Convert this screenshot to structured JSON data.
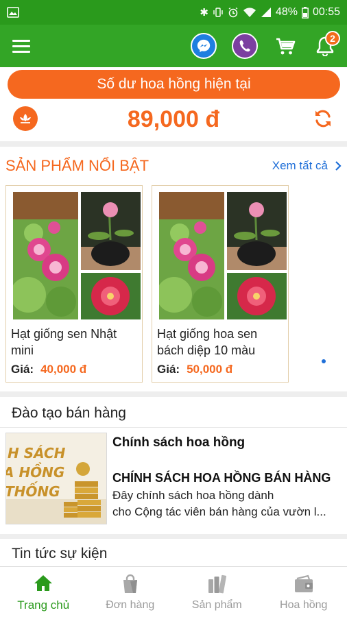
{
  "status_bar": {
    "battery": "48%",
    "time": "00:55",
    "icons": [
      "image-icon",
      "bluetooth-icon",
      "vibrate-icon",
      "alarm-icon",
      "wifi-icon",
      "signal-icon",
      "battery-icon"
    ]
  },
  "app_bar": {
    "icons": [
      "menu-icon",
      "messenger-icon",
      "viber-icon",
      "cart-icon",
      "bell-icon"
    ],
    "notification_count": "2"
  },
  "balance": {
    "label": "Số dư hoa hồng hiện tại",
    "amount": "89,000 đ"
  },
  "featured": {
    "title": "SẢN PHẨM NỔI BẬT",
    "see_all": "Xem tất cả",
    "products": [
      {
        "name_line1": "Hạt giống sen Nhật",
        "name_line2": "mini",
        "price_label": "Giá:",
        "price": "40,000 đ"
      },
      {
        "name_line1": "Hạt giống hoa sen",
        "name_line2": "bách diệp 10 màu",
        "price_label": "Giá:",
        "price": "50,000 đ"
      }
    ]
  },
  "training": {
    "title": "Đào tạo bán hàng",
    "article": {
      "thumb_text_1": "H SÁCH",
      "thumb_text_2": "A HỒNG",
      "thumb_text_3": "THỐNG",
      "title": "Chính sách hoa hồng",
      "heading": "CHÍNH SÁCH HOA HỒNG BÁN HÀNG",
      "desc_line1": "Đây chính sách hoa hồng dành",
      "desc_line2": "cho Cộng tác viên bán hàng của vườn l..."
    }
  },
  "news": {
    "title": "Tin tức sự kiện"
  },
  "bottom_nav": {
    "items": [
      {
        "label": "Trang chủ",
        "icon": "home-icon",
        "active": true
      },
      {
        "label": "Đơn hàng",
        "icon": "bag-icon",
        "active": false
      },
      {
        "label": "Sản phẩm",
        "icon": "products-icon",
        "active": false
      },
      {
        "label": "Hoa hồng",
        "icon": "wallet-icon",
        "active": false
      }
    ]
  },
  "colors": {
    "status_bar": "#2a9a1c",
    "app_bar": "#33a526",
    "accent_orange": "#f5681f",
    "link_blue": "#1f6fd8",
    "active_green": "#2a9a1c"
  }
}
